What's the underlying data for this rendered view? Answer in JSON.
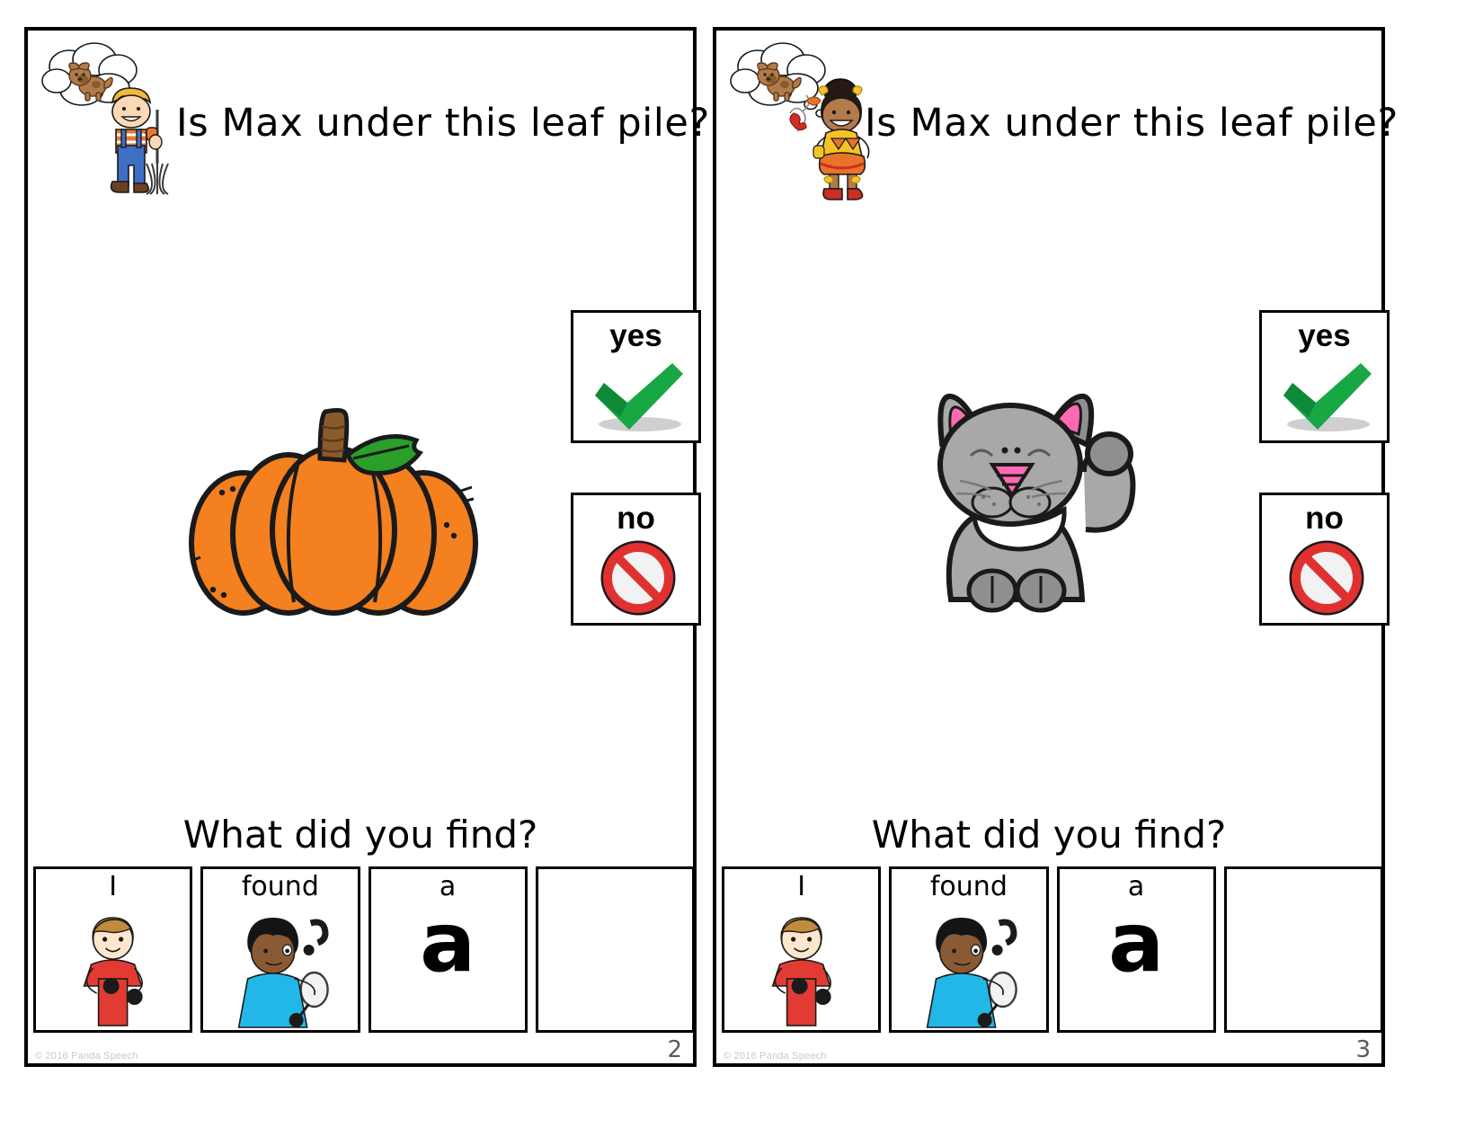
{
  "document": {
    "type": "interactive-adapted-book-page-spread",
    "copyright": "© 2016 Panda Speech"
  },
  "pages": [
    {
      "id": "page-2",
      "page_number": "2",
      "character": {
        "name": "boy-raking-leaves",
        "description": "blond boy in blue overalls holding a rake",
        "hair_color": "#f0b93c",
        "shirt_color": "#e8792c",
        "overalls_color": "#3f6fc4",
        "shoe_color": "#6b4022"
      },
      "thought_bubble": {
        "name": "thought-bubble-dog",
        "contains": "dog",
        "dog_color": "#b07b4b"
      },
      "question": "Is Max under this leaf pile?",
      "answers": [
        {
          "label": "yes",
          "icon": "green-check-icon",
          "color": "#17a745"
        },
        {
          "label": "no",
          "icon": "red-prohibition-icon",
          "color": "#e03131"
        }
      ],
      "found_object": {
        "name": "pumpkin",
        "body_color": "#f4801f",
        "stem_color": "#8a5a2b",
        "leaf_color": "#2aa02a"
      },
      "prompt": "What did you find?",
      "sentence_strip": [
        {
          "word": "I",
          "art": "boy-pointing-at-self-icon",
          "big_letter": ""
        },
        {
          "word": "found",
          "art": "boy-with-magnifying-glass-icon",
          "big_letter": ""
        },
        {
          "word": "a",
          "art": "",
          "big_letter": "a"
        },
        {
          "word": "",
          "art": "",
          "big_letter": ""
        }
      ]
    },
    {
      "id": "page-3",
      "page_number": "3",
      "character": {
        "name": "girl-in-fall-costume",
        "description": "dark-haired girl in yellow and orange autumn outfit",
        "hair_color": "#241a13",
        "shirt_color": "#f6c324",
        "skirt_color": "#e8732a",
        "shoe_color": "#cc2d24"
      },
      "thought_bubble": {
        "name": "thought-bubble-dog",
        "contains": "dog",
        "dog_color": "#b07b4b"
      },
      "question": "Is Max under this leaf pile?",
      "answers": [
        {
          "label": "yes",
          "icon": "green-check-icon",
          "color": "#17a745"
        },
        {
          "label": "no",
          "icon": "red-prohibition-icon",
          "color": "#e03131"
        }
      ],
      "found_object": {
        "name": "cat",
        "body_color": "#a8a8a8",
        "accent_color": "#ff69b4",
        "chest_color": "#ffffff"
      },
      "prompt": "What did you find?",
      "sentence_strip": [
        {
          "word": "I",
          "art": "boy-pointing-at-self-icon",
          "big_letter": ""
        },
        {
          "word": "found",
          "art": "boy-with-magnifying-glass-icon",
          "big_letter": ""
        },
        {
          "word": "a",
          "art": "",
          "big_letter": "a"
        },
        {
          "word": "",
          "art": "",
          "big_letter": ""
        }
      ]
    }
  ]
}
